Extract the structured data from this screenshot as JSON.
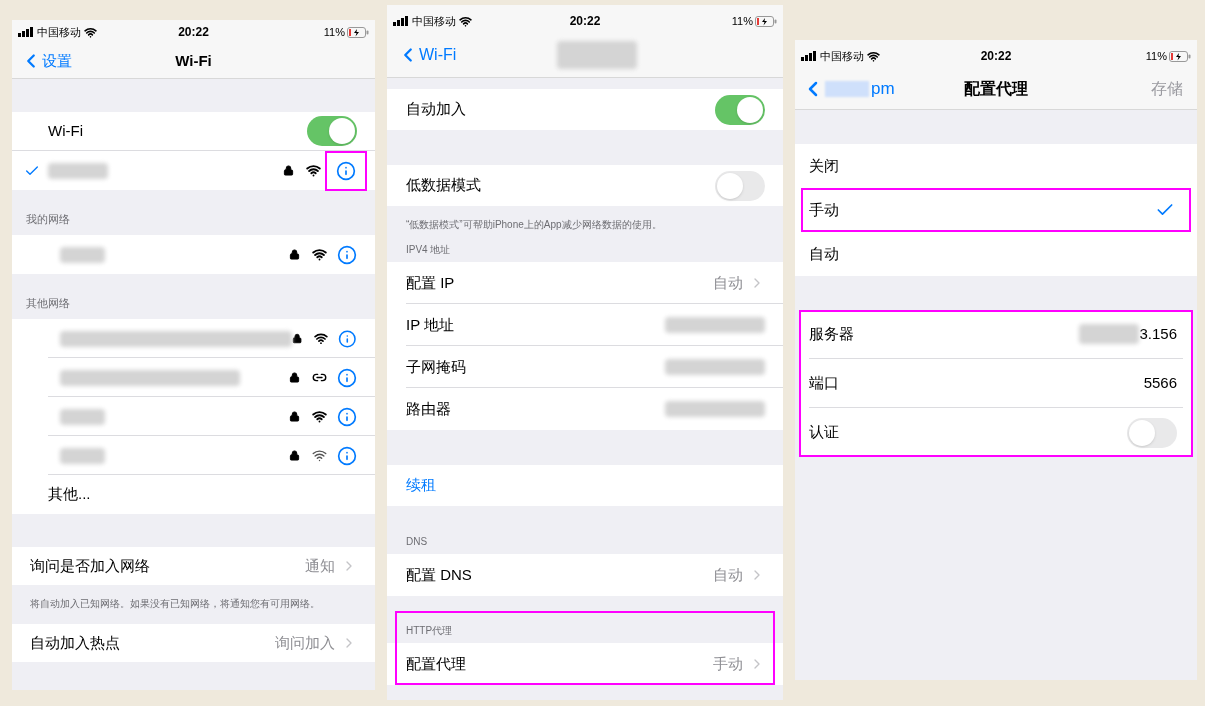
{
  "wifi_screen": {
    "status_bar": {
      "carrier": "中国移动",
      "time": "20:22",
      "battery": "11%"
    },
    "back": "设置",
    "title": "Wi-Fi",
    "wifi_toggle": {
      "label": "Wi-Fi",
      "on": true
    },
    "current_network": {
      "connected": true,
      "locked": true,
      "kind": "wifi",
      "info_highlighted": true
    },
    "sections": [
      {
        "header": "我的网络",
        "networks": [
          {
            "locked": true,
            "kind": "wifi"
          }
        ]
      },
      {
        "header": "其他网络",
        "networks": [
          {
            "locked": true,
            "kind": "wifi"
          },
          {
            "locked": true,
            "kind": "hotspot"
          },
          {
            "locked": true,
            "kind": "wifi"
          },
          {
            "locked": true,
            "kind": "weak"
          }
        ],
        "other": "其他..."
      }
    ],
    "ask_join": {
      "label": "询问是否加入网络",
      "value": "通知",
      "footnote": "将自动加入已知网络。如果没有已知网络，将通知您有可用网络。"
    },
    "auto_hotspot": {
      "label": "自动加入热点",
      "value": "询问加入"
    }
  },
  "network_screen": {
    "status_bar": {
      "carrier": "中国移动",
      "time": "20:22",
      "battery": "11%"
    },
    "back": "Wi-Fi",
    "auto_join": {
      "label": "自动加入",
      "on": true
    },
    "low_data": {
      "label": "低数据模式",
      "on": false,
      "footnote": "“低数据模式”可帮助iPhone上的App减少网络数据的使用。"
    },
    "ipv4": {
      "header": "IPV4 地址",
      "rows": [
        {
          "kind": "link",
          "label": "配置 IP",
          "value": "自动"
        },
        {
          "kind": "redacted",
          "label": "IP 地址"
        },
        {
          "kind": "redacted",
          "label": "子网掩码"
        },
        {
          "kind": "redacted",
          "label": "路由器"
        }
      ]
    },
    "renew": "续租",
    "dns": {
      "header": "DNS",
      "label": "配置 DNS",
      "value": "自动"
    },
    "http": {
      "header": "HTTP代理",
      "label": "配置代理",
      "value": "手动",
      "highlighted": true
    }
  },
  "proxy_screen": {
    "status_bar": {
      "carrier": "中国移动",
      "time": "20:22",
      "battery": "11%"
    },
    "back": "pm",
    "title": "配置代理",
    "save": {
      "label": "存储",
      "disabled": true
    },
    "modes": [
      {
        "label": "关闭",
        "selected": false,
        "highlighted": false
      },
      {
        "label": "手动",
        "selected": true,
        "highlighted": true
      },
      {
        "label": "自动",
        "selected": false,
        "highlighted": false
      }
    ],
    "settings": {
      "highlighted": true,
      "rows": [
        {
          "kind": "masked_value",
          "label": "服务器",
          "value": "3.156"
        },
        {
          "kind": "value",
          "label": "端口",
          "value": "5566"
        },
        {
          "kind": "toggle",
          "label": "认证",
          "on": false
        }
      ]
    }
  }
}
